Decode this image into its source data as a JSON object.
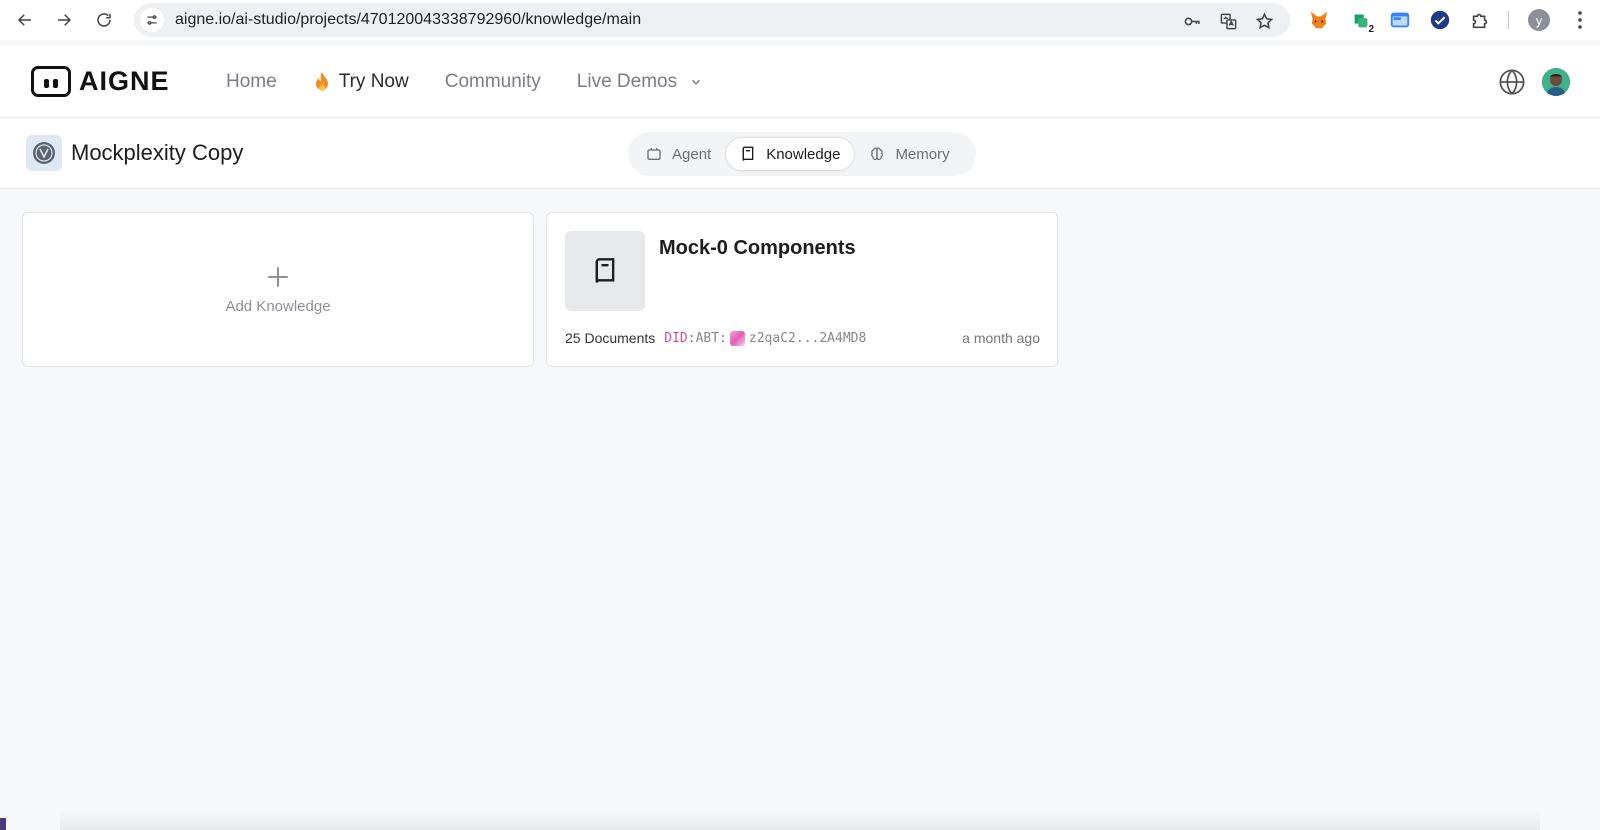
{
  "browser": {
    "url": "aigne.io/ai-studio/projects/470120043338792960/knowledge/main",
    "extension_badge": "2",
    "profile_initial": "y"
  },
  "header": {
    "logo_text": "AIGNE",
    "nav": [
      {
        "label": "Home"
      },
      {
        "label": "Try Now"
      },
      {
        "label": "Community"
      },
      {
        "label": "Live Demos"
      }
    ]
  },
  "project": {
    "title": "Mockplexity Copy",
    "tabs": [
      {
        "label": "Agent",
        "icon": "robot-icon"
      },
      {
        "label": "Knowledge",
        "icon": "book-icon",
        "active": true
      },
      {
        "label": "Memory",
        "icon": "brain-icon"
      }
    ]
  },
  "content": {
    "add_label": "Add Knowledge",
    "knowledge": {
      "title": "Mock-0 Components",
      "documents": "25 Documents",
      "did_prefix": "DID:",
      "did_abt": "ABT:",
      "did_value": "z2qaC2...2A4MD8",
      "time": "a month ago"
    }
  },
  "colors": {
    "did_prefix": "#d04fa4",
    "active_nav": "#2a2c31",
    "muted_nav": "#7a7d85",
    "flame": "#f28c28"
  }
}
